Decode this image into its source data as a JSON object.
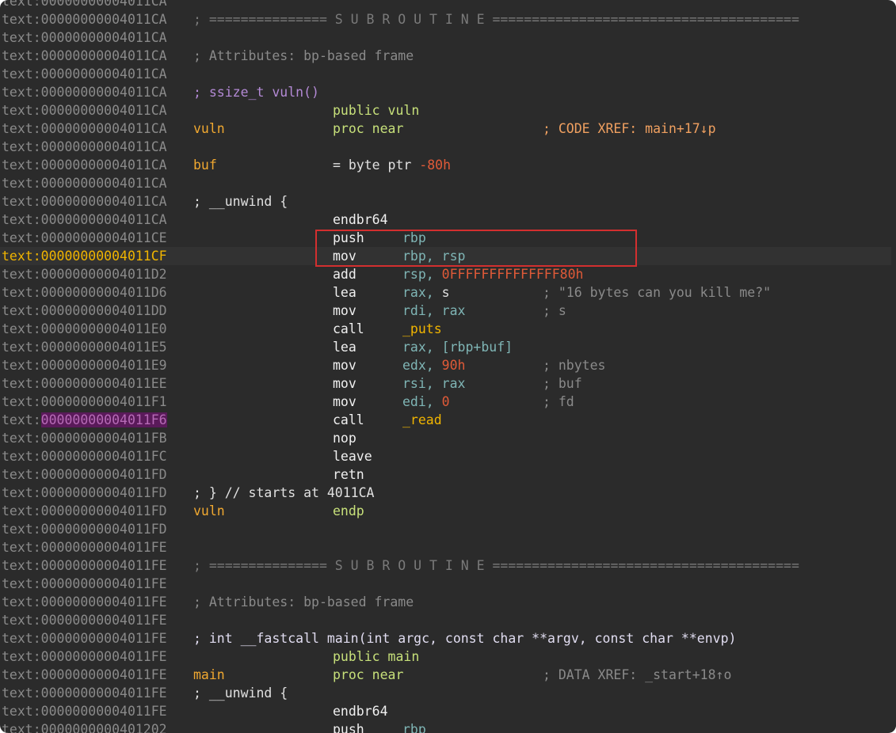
{
  "lines": [
    {
      "addr": "text:00000000004011CA"
    },
    {
      "addr": "text:00000000004011CA",
      "sub": "; =============== S U B R O U T I N E ======================================="
    },
    {
      "addr": "text:00000000004011CA"
    },
    {
      "addr": "text:00000000004011CA",
      "comment": "; Attributes: bp-based frame"
    },
    {
      "addr": "text:00000000004011CA"
    },
    {
      "addr": "text:00000000004011CA",
      "proto": "; ssize_t vuln()"
    },
    {
      "addr": "text:00000000004011CA",
      "kw": "public vuln"
    },
    {
      "addr": "text:00000000004011CA",
      "label": "vuln",
      "kw": "proc near",
      "xref": "; CODE XREF: main+17↓p"
    },
    {
      "addr": "text:00000000004011CA"
    },
    {
      "addr": "text:00000000004011CA",
      "label": "buf",
      "eq": "= byte ptr ",
      "eqnum": "-80h"
    },
    {
      "addr": "text:00000000004011CA"
    },
    {
      "addr": "text:00000000004011CA",
      "brace": "; __unwind {"
    },
    {
      "addr": "text:00000000004011CA",
      "mnem": "endbr64"
    },
    {
      "addr": "text:00000000004011CE",
      "mnem": "push",
      "op1": "rbp"
    },
    {
      "addr": "text:00000000004011CF",
      "mnem": "mov",
      "op1": "rbp, rsp",
      "current": true
    },
    {
      "addr": "text:00000000004011D2",
      "mnem": "add",
      "op1": "rsp, ",
      "num": "0FFFFFFFFFFFFFF80h"
    },
    {
      "addr": "text:00000000004011D6",
      "mnem": "lea",
      "op1": "rax, ",
      "plain": "s",
      "cmt": "; \"16 bytes can you kill me?\""
    },
    {
      "addr": "text:00000000004011DD",
      "mnem": "mov",
      "op1": "rdi, rax",
      "cmt": "; s"
    },
    {
      "addr": "text:00000000004011E0",
      "mnem": "call",
      "sym": "_puts"
    },
    {
      "addr": "text:00000000004011E5",
      "mnem": "lea",
      "op1": "rax, [rbp+buf]"
    },
    {
      "addr": "text:00000000004011E9",
      "mnem": "mov",
      "op1": "edx, ",
      "num": "90h",
      "cmt": "; nbytes"
    },
    {
      "addr": "text:00000000004011EE",
      "mnem": "mov",
      "op1": "rsi, rax",
      "cmt": "; buf"
    },
    {
      "addr": "text:00000000004011F1",
      "mnem": "mov",
      "op1": "edi, ",
      "num": "0",
      "cmt": "; fd"
    },
    {
      "addr": "text:00000000004011F6",
      "mnem": "call",
      "sym": "_read",
      "hl": true
    },
    {
      "addr": "text:00000000004011FB",
      "mnem": "nop"
    },
    {
      "addr": "text:00000000004011FC",
      "mnem": "leave"
    },
    {
      "addr": "text:00000000004011FD",
      "mnem": "retn"
    },
    {
      "addr": "text:00000000004011FD",
      "brace": "; } // starts at 4011CA"
    },
    {
      "addr": "text:00000000004011FD",
      "label": "vuln",
      "kw": "endp"
    },
    {
      "addr": "text:00000000004011FD"
    },
    {
      "addr": "text:00000000004011FE"
    },
    {
      "addr": "text:00000000004011FE",
      "sub": "; =============== S U B R O U T I N E ======================================="
    },
    {
      "addr": "text:00000000004011FE"
    },
    {
      "addr": "text:00000000004011FE",
      "comment": "; Attributes: bp-based frame"
    },
    {
      "addr": "text:00000000004011FE"
    },
    {
      "addr": "text:00000000004011FE",
      "proto2": "; int __fastcall main(int argc, const char **argv, const char **envp)"
    },
    {
      "addr": "text:00000000004011FE",
      "kw": "public main"
    },
    {
      "addr": "text:00000000004011FE",
      "label": "main",
      "kw": "proc near",
      "xref": "; DATA XREF: _start+18↑o",
      "xrefData": true
    },
    {
      "addr": "text:00000000004011FE",
      "brace": "; __unwind {"
    },
    {
      "addr": "text:00000000004011FE",
      "mnem": "endbr64"
    },
    {
      "addr": "text:0000000000401202",
      "mnem": "push",
      "op1": "rbp"
    }
  ]
}
